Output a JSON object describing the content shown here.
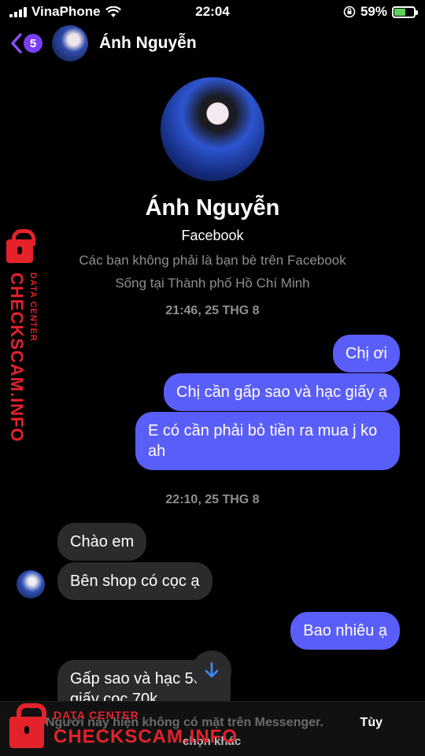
{
  "status_bar": {
    "carrier": "VinaPhone",
    "time": "22:04",
    "battery": "59%",
    "battery_level": 0.59
  },
  "header": {
    "back_count": "5",
    "name": "Ánh Nguyễn"
  },
  "profile": {
    "name": "Ánh Nguyễn",
    "source": "Facebook",
    "not_friends": "Các bạn không phải là bạn bè trên Facebook",
    "location": "Sống tại Thành phố Hồ Chí Minh"
  },
  "conversation": {
    "timestamp_1": "21:46, 25 THG 8",
    "timestamp_2": "22:10, 25 THG 8",
    "messages": [
      {
        "from": "me",
        "text": "Chị ơi"
      },
      {
        "from": "me",
        "text": "Chị cần gấp sao và hạc giấy ạ"
      },
      {
        "from": "me",
        "text": "E có cần phải bỏ tiền ra mua j ko ah"
      },
      {
        "from": "them",
        "text": "Chào em"
      },
      {
        "from": "them",
        "text": "Bên shop có cọc ạ"
      },
      {
        "from": "me",
        "text": "Bao nhiêu ạ"
      },
      {
        "from": "them",
        "text": "Gấp sao và hạc 500 giấy cọc 70k"
      }
    ]
  },
  "footer": {
    "notice": "Người này hiện không có mặt trên Messenger.",
    "option": "Tùy",
    "option_line2": "chọn khác"
  },
  "watermark": {
    "small": "DATA CENTER",
    "big": "CHECKSCAM.INFO"
  },
  "icons": {
    "back": "chevron-left-icon",
    "wifi": "wifi-icon",
    "orientation_lock": "orientation-lock-icon",
    "battery": "battery-icon",
    "scroll_down": "arrow-down-icon",
    "lock": "lock-icon"
  },
  "colors": {
    "outgoing_bubble": "#5a5ef9",
    "incoming_bubble": "#2b2b2d",
    "accent": "#8a4dff",
    "watermark": "#e3222b"
  }
}
